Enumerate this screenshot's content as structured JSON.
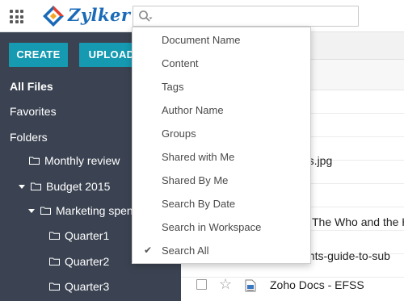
{
  "app": {
    "logo_text": "Zylker"
  },
  "search": {
    "placeholder": ""
  },
  "sidebar": {
    "create_label": "CREATE",
    "upload_label": "UPLOAD",
    "nav": [
      "All Files",
      "Favorites",
      "Folders"
    ],
    "folders": [
      {
        "label": "Monthly review",
        "expanded": false
      },
      {
        "label": "Budget 2015",
        "expanded": true
      },
      {
        "label": "Marketing spen",
        "expanded": true
      },
      {
        "label": "Quarter1",
        "expanded": false
      },
      {
        "label": "Quarter2",
        "expanded": false
      },
      {
        "label": "Quarter3",
        "expanded": false
      }
    ]
  },
  "files": {
    "visible_fragments": [
      "ots.jpg",
      "The Who and the H",
      "ants-guide-to-sub"
    ],
    "last_row_name": "Zoho Docs - EFSS"
  },
  "search_dropdown": {
    "items": [
      {
        "label": "Document Name",
        "selected": false
      },
      {
        "label": "Content",
        "selected": false
      },
      {
        "label": "Tags",
        "selected": false
      },
      {
        "label": "Author Name",
        "selected": false
      },
      {
        "label": "Groups",
        "selected": false
      },
      {
        "label": "Shared with Me",
        "selected": false
      },
      {
        "label": "Shared By Me",
        "selected": false
      },
      {
        "label": "Search By Date",
        "selected": false
      },
      {
        "label": "Search in Workspace",
        "selected": false
      },
      {
        "label": "Search All",
        "selected": true
      }
    ],
    "check_glyph": "✔"
  },
  "colors": {
    "sidebar_bg": "#3b4352",
    "accent_teal": "#159ab2",
    "logo_blue": "#1a6ab8",
    "logo_red": "#e8402a",
    "logo_yellow": "#f5a623"
  },
  "icons": {
    "apps": "grid-icon",
    "search": "magnifier-icon",
    "folder": "folder-outline-icon",
    "star": "star-outline-icon"
  }
}
